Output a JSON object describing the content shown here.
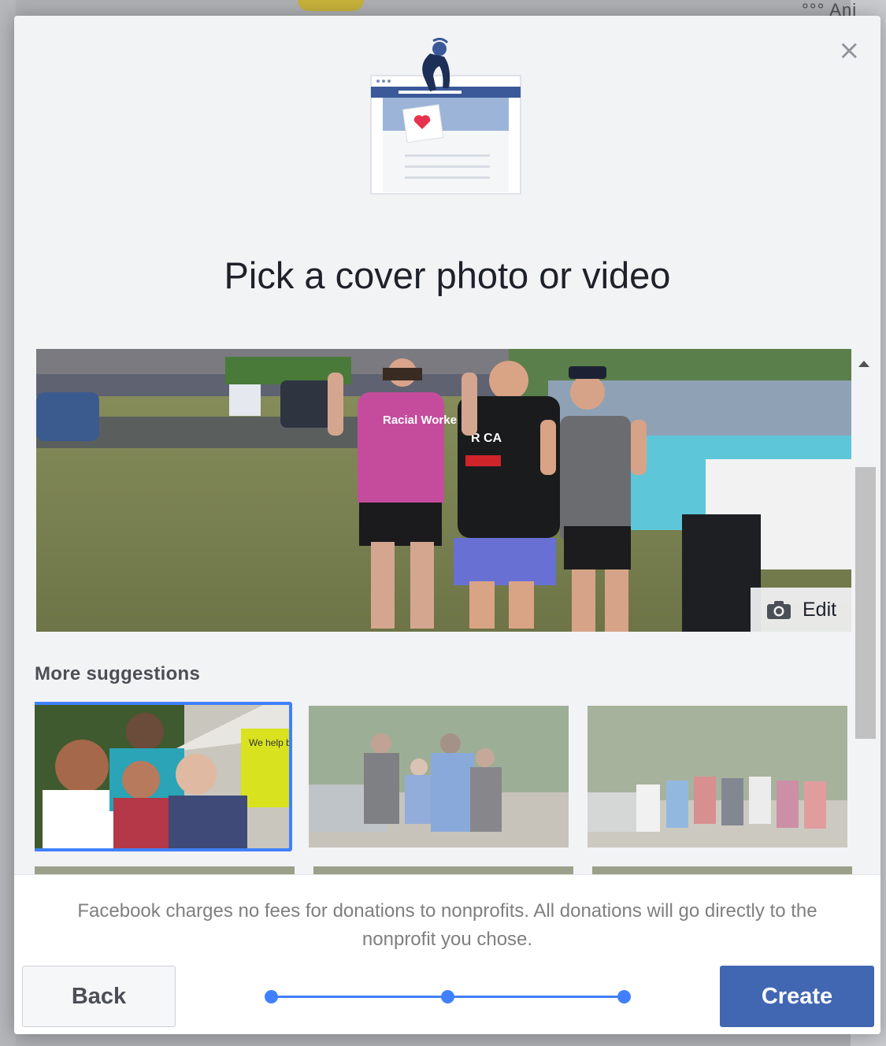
{
  "background": {
    "top_right_text": "°°° Ani"
  },
  "dialog": {
    "close_label": "×",
    "title": "Pick a cover photo or video",
    "cover": {
      "edit_label": "Edit",
      "shirt_text": "Racial Workers",
      "shirt_text_2": "R CA"
    },
    "suggestions": {
      "heading": "More suggestions",
      "items": [
        {
          "sign_text": "We help build st... stabilit... self-rel... through"
        },
        {},
        {}
      ]
    },
    "footer": {
      "notice": "Facebook charges no fees for donations to nonprofits. All donations will go directly to the nonprofit you chose.",
      "back_label": "Back",
      "create_label": "Create",
      "steps_total": 3,
      "current_step": 3
    }
  },
  "colors": {
    "primary": "#4267b2",
    "accent": "#4080ff",
    "heart": "#e8314d"
  }
}
